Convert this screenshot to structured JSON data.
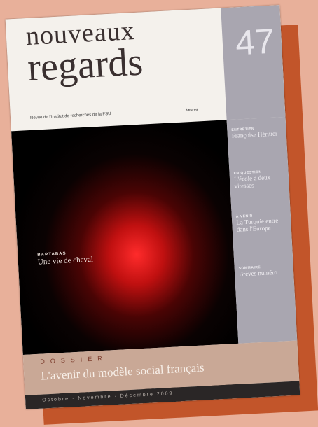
{
  "cover": {
    "title_line1": "nouveaux",
    "title_line2": "regards",
    "issue_number": "47",
    "subtitle": "Revue de l'Institut de recherches de la FSU",
    "price": "8 euros"
  },
  "feature": {
    "kicker": "BARTABAS",
    "caption": "Une vie de cheval"
  },
  "sidebar": {
    "items": [
      {
        "head": "ENTRETIEN",
        "text": "Françoise Héritier"
      },
      {
        "head": "EN QUESTION",
        "text": "L'école à deux vitesses"
      },
      {
        "head": "À VENIR",
        "text": "La Turquie entre dans l'Europe"
      },
      {
        "head": "SOMMAIRE",
        "text": "Brèves numéro"
      }
    ]
  },
  "dossier": {
    "label": "DOSSIER",
    "title": "L'avenir du modèle social français"
  },
  "date_line": "Octobre · Novembre · Décembre 2009",
  "colors": {
    "background": "#e8b09a",
    "shadow": "#c2552a",
    "sidebar": "#a9a6b0",
    "dossier_band": "#c9a896",
    "date_band": "#2a2626"
  }
}
